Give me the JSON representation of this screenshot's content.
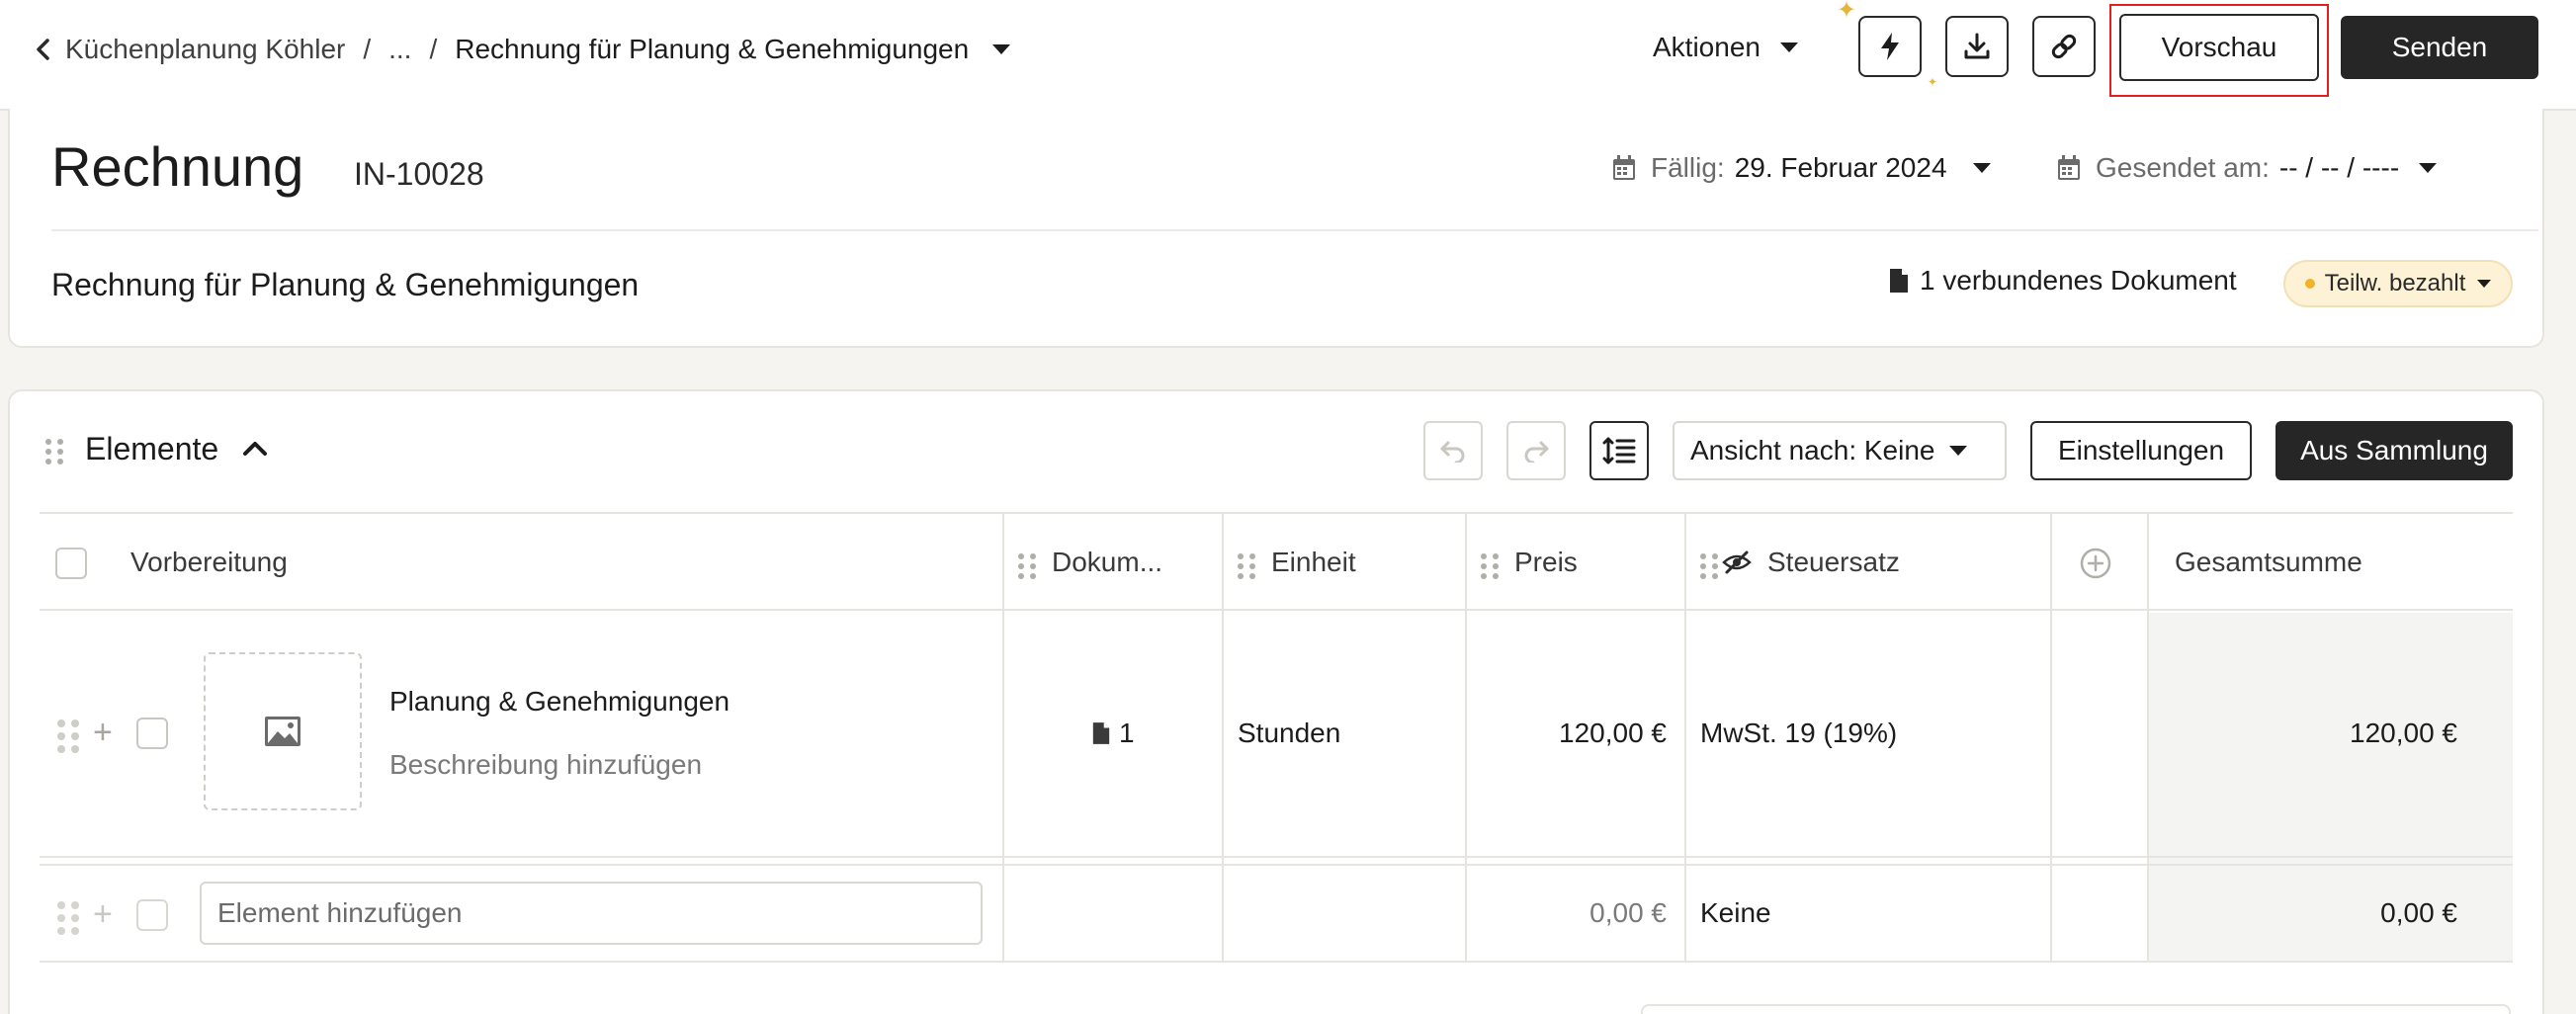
{
  "breadcrumb": {
    "parent": "Küchenplanung Köhler",
    "ellipsis": "...",
    "current": "Rechnung für Planung & Genehmigungen"
  },
  "toolbar": {
    "actions_label": "Aktionen",
    "icons": [
      "lightning-icon",
      "download-icon",
      "link-icon"
    ],
    "preview_label": "Vorschau",
    "send_label": "Senden"
  },
  "invoice": {
    "title": "Rechnung",
    "number": "IN-10028",
    "due_label": "Fällig:",
    "due_value": "29. Februar 2024",
    "sent_label": "Gesendet am:",
    "sent_value": "-- / -- / ----",
    "subtitle": "Rechnung für Planung & Genehmigungen",
    "linked_docs": "1 verbundenes Dokument",
    "status": "Teilw. bezahlt"
  },
  "items_section": {
    "title": "Elemente",
    "view_by": "Ansicht nach: Keine",
    "settings_label": "Einstellungen",
    "from_collection_label": "Aus Sammlung"
  },
  "table": {
    "columns": [
      "Vorbereitung",
      "Dokum...",
      "Einheit",
      "Preis",
      "Steuersatz",
      "Gesamtsumme"
    ],
    "rows": [
      {
        "name": "Planung & Genehmigungen",
        "description": "Beschreibung hinzufügen",
        "docs": "1",
        "unit": "Stunden",
        "price": "120,00 €",
        "tax": "MwSt. 19 (19%)",
        "total": "120,00 €"
      }
    ],
    "new_row": {
      "placeholder": "Element hinzufügen",
      "price": "0,00 €",
      "tax": "Keine",
      "total": "0,00 €"
    }
  },
  "colors": {
    "accent_dark": "#262626",
    "highlight": "#e02020",
    "status_bg": "#fdf1d6",
    "status_dot": "#f0b429"
  }
}
